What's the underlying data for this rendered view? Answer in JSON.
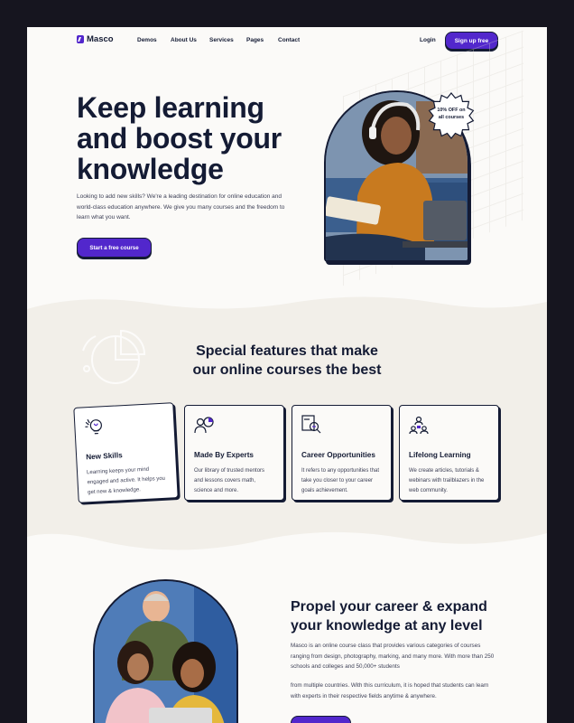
{
  "nav": {
    "logo": "Masco",
    "links": [
      {
        "label": "Demos",
        "icon": "chevron-down-icon"
      },
      {
        "label": "About Us",
        "icon": "chevron-down-icon"
      },
      {
        "label": "Services",
        "icon": "chevron-down-icon"
      },
      {
        "label": "Pages",
        "icon": "chevron-down-icon"
      },
      {
        "label": "Contact",
        "icon": ""
      }
    ],
    "login": "Login",
    "signup": "Sign up free"
  },
  "hero": {
    "title": "Keep learning and boost your knowledge",
    "description": "Looking to add new skills? We're a leading destination for online education and world-class education anywhere. We give you many courses and the freedom to learn what you want.",
    "cta": "Start a free course",
    "badge_line1": "10% OFF on",
    "badge_line2": "all courses"
  },
  "features": {
    "title_line1": "Special features that make",
    "title_line2": "our online courses the best",
    "cards": [
      {
        "icon": "brain-lightbulb-icon",
        "title": "New Skills",
        "desc": "Learning keeps your mind engaged and active. It helps you get new & knowledge."
      },
      {
        "icon": "expert-pointer-icon",
        "title": "Made By Experts",
        "desc": "Our library of trusted mentors and lessons covers math, science and more."
      },
      {
        "icon": "job-search-icon",
        "title": "Career Opportunities",
        "desc": "It refers to any opportunities that take you closer to your career goals achievement."
      },
      {
        "icon": "team-network-icon",
        "title": "Lifelong Learning",
        "desc": "We create articles, tutorials & webinars with trailblazers in the web community."
      }
    ]
  },
  "career": {
    "title_line1": "Propel your career & expand",
    "title_line2": "your knowledge at any level",
    "paragraph1": "Masco is an online course class that provides various categories of courses ranging from design, photography, marking, and many more. With more than 250 schools and colleges and 50,000+ students",
    "paragraph2": "from multiple countries. With this curriculum, it is hoped that students can learn with experts in their respective fields anytime & anywhere."
  },
  "colors": {
    "accent": "#5227cc",
    "ink": "#141b34",
    "band": "#f2efe9",
    "frame": "#16151f"
  }
}
